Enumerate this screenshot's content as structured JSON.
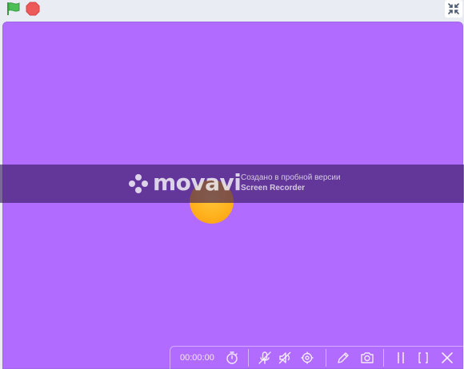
{
  "toolbar": {
    "green_flag_icon": "green-flag-icon",
    "stop_icon": "stop-sign-icon",
    "fullscreen_icon": "exit-fullscreen-icon"
  },
  "colors": {
    "stage_background": "#b16bff",
    "ball": "#ffb21e",
    "flag_green": "#4cbf56",
    "stop_red": "#ec5959",
    "watermark_band": "#34185c"
  },
  "watermark": {
    "brand": "movavi",
    "line1": "Создано в пробной версии",
    "line2": "Screen Recorder"
  },
  "recorder": {
    "timer": "00:00:00",
    "icons": [
      "stopwatch-icon",
      "mic-muted-icon",
      "speaker-muted-icon",
      "webcam-icon",
      "pencil-icon",
      "camera-icon",
      "pause-icon",
      "bracket-icon",
      "close-icon"
    ]
  }
}
